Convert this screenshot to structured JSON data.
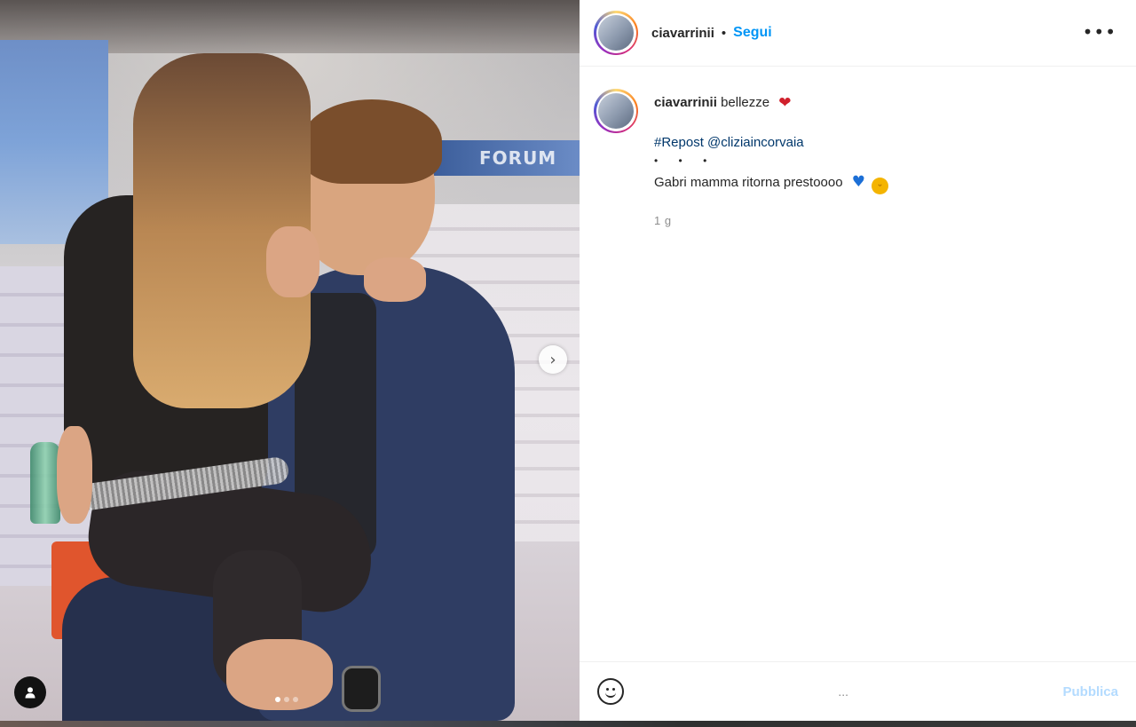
{
  "post": {
    "username": "ciavarrinii",
    "separator": "•",
    "follow_label": "Segui",
    "more_label": "•••"
  },
  "photo": {
    "banner_text": "FORUM",
    "next_icon": "chevron-right-icon",
    "carousel": {
      "total": 3,
      "active": 1
    },
    "tag_icon": "user-tag-icon"
  },
  "caption": {
    "author": "ciavarrinii",
    "text": "bellezze",
    "heart_emoji": "❤",
    "hashtag": "#Repost",
    "mention": "@cliziaincorvaia",
    "dots": "• • •",
    "message": "Gabri mamma ritorna prestoooo",
    "blue_heart": "♥",
    "tongue_face": "😛",
    "time": "1 g"
  },
  "comment_box": {
    "placeholder": "...",
    "publish_label": "Pubblica",
    "emoji_icon": "smiley-icon"
  },
  "colors": {
    "link_blue": "#0095f6",
    "hashtag_blue": "#00376b",
    "publish_disabled": "#b3dbff",
    "heart_red": "#d0202c"
  }
}
